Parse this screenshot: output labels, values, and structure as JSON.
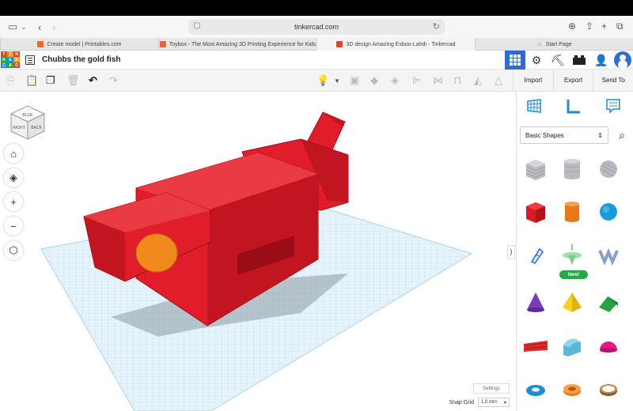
{
  "browser": {
    "url": "tinkercad.com",
    "tabs": [
      {
        "label": "Create model | Printables.com",
        "active": false,
        "favicon_color": "#f06a2c"
      },
      {
        "label": "Toybox - The Most Amazing 3D Printing Experience for Kids",
        "active": false,
        "favicon_color": "#ff5b3a"
      },
      {
        "label": "3D design Amazing Esboo-Lahdi - Tinkercad",
        "active": true,
        "favicon_color": "#e8412a"
      },
      {
        "label": "Start Page",
        "active": false,
        "favicon_color": "#777777"
      }
    ]
  },
  "app": {
    "logo_letters": [
      "T",
      "I",
      "N",
      "K",
      "E",
      "R",
      "C",
      "A",
      "D"
    ],
    "title": "Chubbs the gold fish"
  },
  "toolbar_right": {
    "import": "Import",
    "export": "Export",
    "send_to": "Send To"
  },
  "viewcube": {
    "top": "BLUE",
    "left": "RIGHT",
    "right": "BACK"
  },
  "canvas": {
    "settings": "Settings",
    "snap_label": "Snap Grid",
    "snap_value": "1.0 mm",
    "workplane_label": "Workplane"
  },
  "panel": {
    "category": "Basic Shapes",
    "new_badge": "New!",
    "shapes": [
      {
        "name": "box-hole-shape",
        "color": "#b0b3b8"
      },
      {
        "name": "cylinder-hole-shape",
        "color": "#b0b3b8"
      },
      {
        "name": "sphere-hole-shape",
        "color": "#b0b3b8"
      },
      {
        "name": "box-shape",
        "color": "#e02428"
      },
      {
        "name": "cylinder-shape",
        "color": "#f07f1e"
      },
      {
        "name": "sphere-shape",
        "color": "#1a9bd7"
      },
      {
        "name": "scribble-shape",
        "color": "#2b6fd6"
      },
      {
        "name": "spinner-shape",
        "color": "#8fd89a"
      },
      {
        "name": "text-3d-shape",
        "color": "#8aa0c8"
      },
      {
        "name": "cone-shape",
        "color": "#7a3db8"
      },
      {
        "name": "pyramid-shape",
        "color": "#f4d21f"
      },
      {
        "name": "roof-shape",
        "color": "#2aa044"
      },
      {
        "name": "text-shape",
        "color": "#d92b2b"
      },
      {
        "name": "half-cylinder-shape",
        "color": "#5bb8d8"
      },
      {
        "name": "half-sphere-shape",
        "color": "#e11c89"
      },
      {
        "name": "torus-shape",
        "color": "#1a8fd1"
      },
      {
        "name": "tube-shape",
        "color": "#f07f1e"
      },
      {
        "name": "ring-shape",
        "color": "#9b6b3a"
      }
    ]
  },
  "colors": {
    "accent": "#2d6cd3",
    "fish_red": "#e11d2b",
    "fish_orange": "#f08a1c",
    "grid": "#cfe8f5"
  }
}
